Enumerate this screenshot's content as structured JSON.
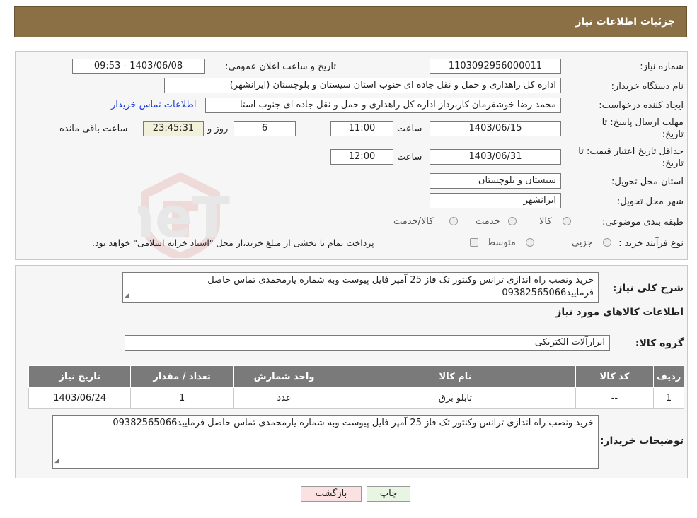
{
  "header": {
    "title": "جزئیات اطلاعات نیاز"
  },
  "form": {
    "need_number_label": "شماره نیاز:",
    "need_number": "1103092956000011",
    "announce_label": "تاریخ و ساعت اعلان عمومی:",
    "announce_value": "1403/06/08 - 09:53",
    "buyer_org_label": "نام دستگاه خریدار:",
    "buyer_org": "اداره کل راهداری و حمل و نقل جاده ای جنوب استان سیستان و بلوچستان (ایرانشهر)",
    "creator_label": "ایجاد کننده درخواست:",
    "creator": "محمد رضا خوشفرمان کاربرداز اداره کل راهداری و حمل و نقل جاده ای جنوب استا",
    "contact_link": "اطلاعات تماس خریدار",
    "deadline_label_line1": "مهلت ارسال پاسخ: تا",
    "deadline_label_line2": "تاریخ:",
    "deadline_date": "1403/06/15",
    "time_label": "ساعت",
    "deadline_time": "11:00",
    "days_value": "6",
    "days_label": "روز و",
    "remaining_time": "23:45:31",
    "remaining_label": "ساعت باقی مانده",
    "validity_label_line1": "حداقل تاریخ اعتبار قیمت: تا",
    "validity_label_line2": "تاریخ:",
    "validity_date": "1403/06/31",
    "validity_time": "12:00",
    "province_label": "استان محل تحویل:",
    "province": "سیستان و بلوچستان",
    "city_label": "شهر محل تحویل:",
    "city": "ایرانشهر",
    "category_label": "طبقه بندی موضوعی:",
    "category_options": [
      "کالا",
      "خدمت",
      "کالا/خدمت"
    ],
    "process_label": "نوع فرآیند خرید :",
    "process_options": [
      "جزیی",
      "متوسط"
    ],
    "process_note": "پرداخت تمام یا بخشی از مبلغ خرید،از محل \"اسناد خزانه اسلامی\" خواهد بود."
  },
  "description": {
    "label": "شرح کلی نیاز:",
    "text": "خرید ونصب راه اندازی ترانس وکنتور تک فاز 25 آمپر فایل پیوست وبه شماره  یارمحمدی  تماس حاصل فرمایید09382565066"
  },
  "goods": {
    "section_title": "اطلاعات کالاهای مورد نیاز",
    "group_label": "گروه کالا:",
    "group_value": "ابزارآلات الکتریکی",
    "columns": [
      "ردیف",
      "کد کالا",
      "نام کالا",
      "واحد شمارش",
      "تعداد / مقدار",
      "تاریخ نیاز"
    ],
    "rows": [
      [
        "1",
        "--",
        "تابلو برق",
        "عدد",
        "1",
        "1403/06/24"
      ]
    ]
  },
  "buyer_notes": {
    "label": "توضیحات خریدار:",
    "text": "خرید ونصب راه اندازی ترانس وکنتور تک فاز 25 آمپر فایل پیوست وبه شماره  یارمحمدی  تماس حاصل فرمایید09382565066"
  },
  "buttons": {
    "print": "چاپ",
    "back": "بازگشت"
  },
  "watermark": {
    "text": "AriaTender.neT"
  },
  "colors": {
    "header_bg": "#8b7046",
    "link": "#1a3fd6",
    "table_header": "#7a7a7a"
  }
}
